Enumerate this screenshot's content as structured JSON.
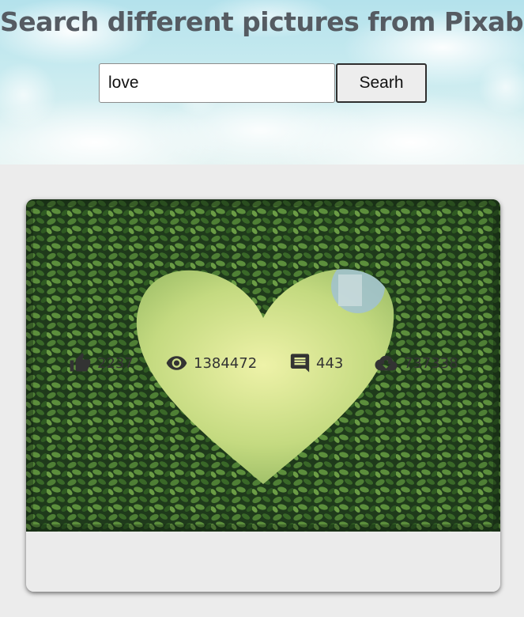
{
  "header": {
    "title": "Search different pictures from Pixabay"
  },
  "search": {
    "value": "love",
    "button_label": "Searh"
  },
  "result": {
    "image_description": "heart-shaped-hedge",
    "stats": {
      "likes": "2237",
      "views": "1384472",
      "comments": "443",
      "downloads": "737338"
    },
    "icons": [
      "thumb-up-icon",
      "eye-icon",
      "comment-icon",
      "download-cloud-icon"
    ]
  },
  "colors": {
    "title": "#555b62",
    "page_background": "#ececec",
    "card_background": "#ebebeb",
    "icon": "#333333"
  }
}
